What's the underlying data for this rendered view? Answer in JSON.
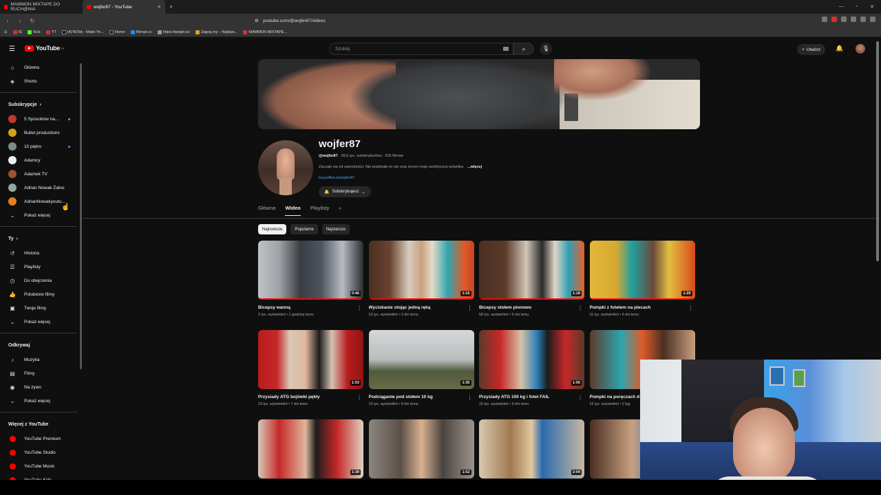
{
  "browser": {
    "tabs": [
      {
        "label": "MAMMON MIXTAPE DO RUCH@NIA",
        "active": false
      },
      {
        "label": "wojfer87 - YouTube",
        "active": true
      }
    ],
    "url": "youtube.com/@wojfer87/videos",
    "bookmarks": [
      "IG",
      "Kick",
      "YT",
      "(4)TikTok - Make Yo...",
      "Home",
      "Filman.cc",
      "https://tangle.io/",
      "Zagraj.my – Najleps...",
      "MAMMON MIXTAPE..."
    ]
  },
  "header": {
    "logo": "YouTube",
    "region": "PL",
    "search_placeholder": "Szukaj",
    "create_label": "Utwórz"
  },
  "sidebar": {
    "main": [
      {
        "label": "Główna",
        "icon": "home-icon",
        "glyph": "⌂"
      },
      {
        "label": "Shorts",
        "icon": "shorts-icon",
        "glyph": "◈"
      }
    ],
    "subscriptions_title": "Subskrypcje",
    "subscriptions": [
      {
        "label": "5 Sposobów na...",
        "color": "#c0392b",
        "dot": true
      },
      {
        "label": "Bullet productions",
        "color": "#d4a017",
        "dot": false
      },
      {
        "label": "10 piętro",
        "color": "#7f8c8d",
        "dot": true
      },
      {
        "label": "Adamcy",
        "color": "#ecf0f1",
        "dot": false
      },
      {
        "label": "Adamek TV",
        "color": "#a0522d",
        "dot": false
      },
      {
        "label": "Adrian Nowak Żalno",
        "color": "#95a5a6",
        "dot": false
      },
      {
        "label": "AdrianNowakyoutu...",
        "color": "#e67e22",
        "dot": false
      }
    ],
    "show_more": "Pokaż więcej",
    "you_title": "Ty",
    "you": [
      {
        "label": "Historia",
        "glyph": "↺",
        "icon": "history-icon"
      },
      {
        "label": "Playlisty",
        "glyph": "☰",
        "icon": "playlist-icon"
      },
      {
        "label": "Do obejrzenia",
        "glyph": "◷",
        "icon": "clock-icon"
      },
      {
        "label": "Polubione filmy",
        "glyph": "👍",
        "icon": "like-icon"
      },
      {
        "label": "Twoje filmy",
        "glyph": "▣",
        "icon": "your-videos-icon"
      }
    ],
    "explore_title": "Odkrywaj",
    "explore": [
      {
        "label": "Muzyka",
        "glyph": "♪",
        "icon": "music-icon"
      },
      {
        "label": "Filmy",
        "glyph": "▤",
        "icon": "film-icon"
      },
      {
        "label": "Na żywo",
        "glyph": "◉",
        "icon": "live-icon"
      }
    ],
    "more_title": "Więcej z YouTube",
    "more": [
      {
        "label": "YouTube Premium"
      },
      {
        "label": "YouTube Studio"
      },
      {
        "label": "YouTube Music"
      },
      {
        "label": "YouTube Kids"
      }
    ]
  },
  "channel": {
    "name": "wojfer87",
    "handle": "@wojfer87",
    "stats": " · 39,5 tys. subskrybentów · 526 filmów",
    "description": "Zacząłe się od samotności. Nie podobała mi się oraz innym moja rachityczna sylwetka",
    "more": "...więcej",
    "link": "buycoffee.to/wojfer87",
    "subscribed_label": "Subskrybujesz",
    "tabs": [
      "Główna",
      "Wideo",
      "Playlisty"
    ],
    "active_tab": 1,
    "chips": [
      "Najnowsze",
      "Popularne",
      "Najstarsze"
    ]
  },
  "videos": [
    {
      "title": "Bicepsy wanną",
      "meta": "2 tys. wyświetleń • 1 godzinę temu",
      "duration": "0:46",
      "thumb": "t1"
    },
    {
      "title": "Wyciskanie stojąc jedną ręką",
      "meta": "23 tys. wyświetleń • 2 dni temu",
      "duration": "1:15",
      "thumb": "t2"
    },
    {
      "title": "Bicepsy stołem pionowo",
      "meta": "58 tys. wyświetleń • 5 dni temu",
      "duration": "1:18",
      "thumb": "t3"
    },
    {
      "title": "Pompki z fotelem na plecach",
      "meta": "11 tys. wyświetleń • 6 dni temu",
      "duration": "1:29",
      "thumb": "t4"
    },
    {
      "title": "Przysiady ATG bojówki pękły",
      "meta": "23 tys. wyświetleń • 7 dni temu",
      "duration": "1:03",
      "thumb": "t5"
    },
    {
      "title": "Podciąganie pod stołem 10 kg",
      "meta": "10 tys. wyświetleń • 8 dni temu",
      "duration": "1:35",
      "thumb": "t6"
    },
    {
      "title": "Przysiady ATG 100 kg i fotel FAIL",
      "meta": "15 tys. wyświetleń • 9 dni temu",
      "duration": "1:05",
      "thumb": "t7"
    },
    {
      "title": "Pompki na poręczach d",
      "meta": "16 tys. wyświetleń • 2 tyg",
      "duration": "",
      "thumb": "t8"
    },
    {
      "title": "",
      "meta": "",
      "duration": "1:39",
      "thumb": "t9"
    },
    {
      "title": "",
      "meta": "",
      "duration": "1:52",
      "thumb": "t10"
    },
    {
      "title": "",
      "meta": "",
      "duration": "2:04",
      "thumb": "t11"
    },
    {
      "title": "",
      "meta": "",
      "duration": "",
      "thumb": "t12"
    }
  ]
}
